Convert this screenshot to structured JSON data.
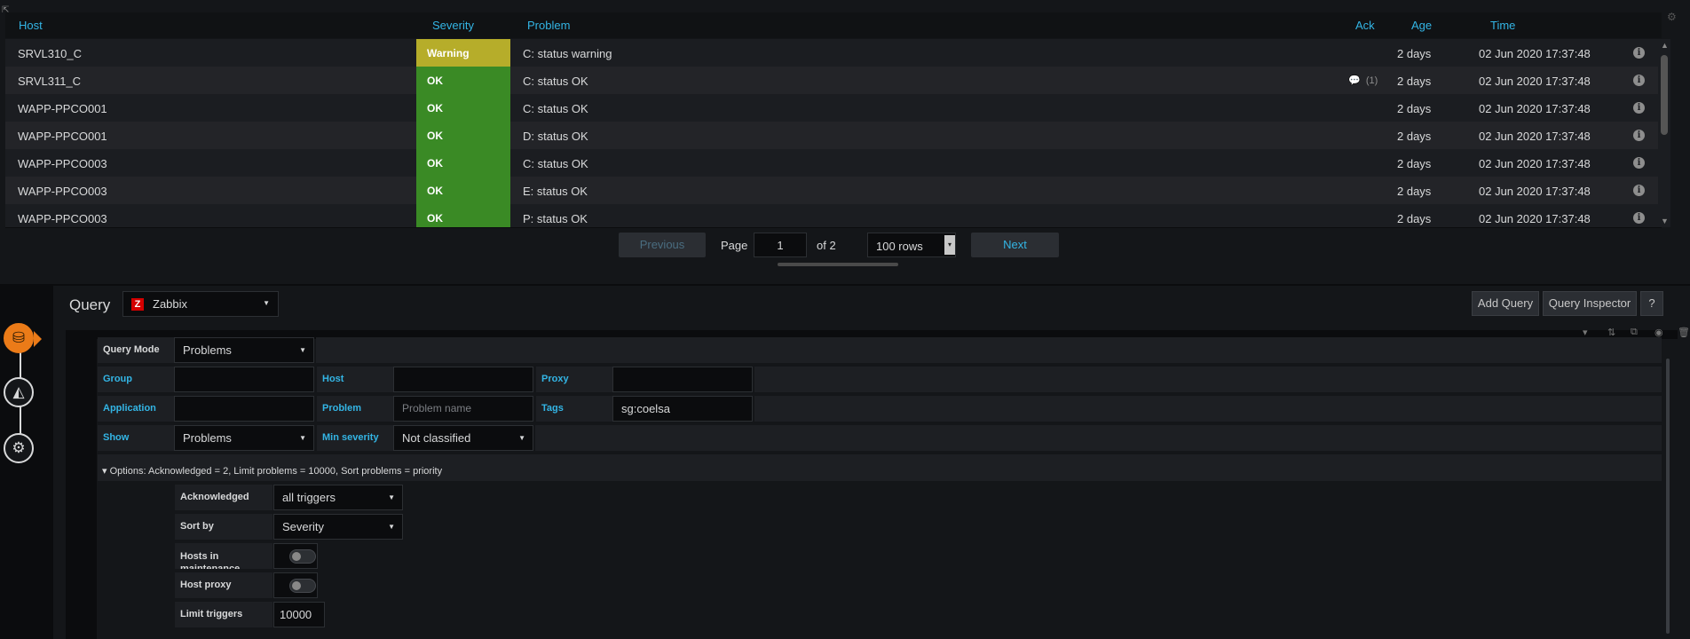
{
  "table": {
    "columns": {
      "host": "Host",
      "severity": "Severity",
      "problem": "Problem",
      "ack": "Ack",
      "age": "Age",
      "time": "Time"
    },
    "rows": [
      {
        "host": "SRVL310_C",
        "severity": "Warning",
        "problem": "C: status warning",
        "ack": "",
        "age": "2 days",
        "time": "02 Jun 2020 17:37:48"
      },
      {
        "host": "SRVL311_C",
        "severity": "OK",
        "problem": "C: status OK",
        "ack": "(1)",
        "age": "2 days",
        "time": "02 Jun 2020 17:37:48"
      },
      {
        "host": "WAPP-PPCO001",
        "severity": "OK",
        "problem": "C: status OK",
        "ack": "",
        "age": "2 days",
        "time": "02 Jun 2020 17:37:48"
      },
      {
        "host": "WAPP-PPCO001",
        "severity": "OK",
        "problem": "D: status OK",
        "ack": "",
        "age": "2 days",
        "time": "02 Jun 2020 17:37:48"
      },
      {
        "host": "WAPP-PPCO003",
        "severity": "OK",
        "problem": "C: status OK",
        "ack": "",
        "age": "2 days",
        "time": "02 Jun 2020 17:37:48"
      },
      {
        "host": "WAPP-PPCO003",
        "severity": "OK",
        "problem": "E: status OK",
        "ack": "",
        "age": "2 days",
        "time": "02 Jun 2020 17:37:48"
      },
      {
        "host": "WAPP-PPCO003",
        "severity": "OK",
        "problem": "P: status OK",
        "ack": "",
        "age": "2 days",
        "time": "02 Jun 2020 17:37:48"
      }
    ],
    "colors": {
      "ok": "#3a8a25",
      "warning": "#b6ad2a",
      "header_text": "#33b5e5"
    }
  },
  "pager": {
    "previous": "Previous",
    "page_label": "Page",
    "page_value": "1",
    "of_label": "of 2",
    "rows_value": "100 rows",
    "next": "Next"
  },
  "query_editor": {
    "title": "Query",
    "datasource": "Zabbix",
    "datasource_logo": "Z",
    "add_query": "Add Query",
    "query_inspector": "Query Inspector",
    "help": "?",
    "query_mode": {
      "label": "Query Mode",
      "value": "Problems"
    },
    "group": {
      "label": "Group",
      "value": ""
    },
    "host": {
      "label": "Host",
      "value": ""
    },
    "proxy": {
      "label": "Proxy",
      "value": ""
    },
    "application": {
      "label": "Application",
      "value": ""
    },
    "problem": {
      "label": "Problem",
      "placeholder": "Problem name"
    },
    "tags": {
      "label": "Tags",
      "value": "sg:coelsa"
    },
    "show": {
      "label": "Show",
      "value": "Problems"
    },
    "min_severity": {
      "label": "Min severity",
      "value": "Not classified"
    },
    "options_summary": "▾ Options: Acknowledged = 2, Limit problems = 10000, Sort problems = priority",
    "acknowledged": {
      "label": "Acknowledged",
      "value": "all triggers"
    },
    "sort_by": {
      "label": "Sort by",
      "value": "Severity"
    },
    "hosts_maintenance": {
      "label": "Hosts in maintenance"
    },
    "host_proxy": {
      "label": "Host proxy"
    },
    "limit_triggers": {
      "label": "Limit triggers",
      "value": "10000"
    }
  },
  "icons": {
    "rail": [
      "database-icon",
      "visualization-icon",
      "general-settings-icon"
    ],
    "row": "info-icon",
    "ack": "comment-icon"
  }
}
